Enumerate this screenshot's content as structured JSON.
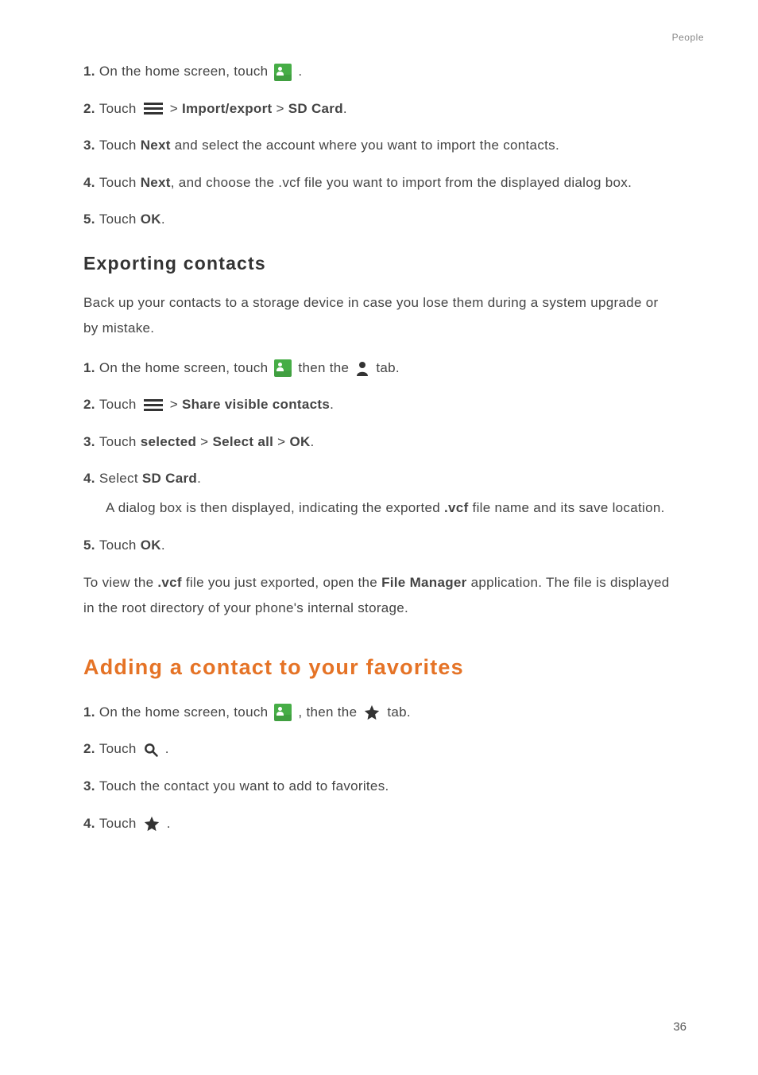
{
  "header": {
    "chapter": "People"
  },
  "import_steps": {
    "s1a": "On the home screen, touch ",
    "s1b": " .",
    "s2a": "Touch ",
    "s2b": " > ",
    "s2c": "Import/export",
    "s2d": " > ",
    "s2e": "SD Card",
    "s2f": ".",
    "s3a": "Touch ",
    "s3b": "Next",
    "s3c": " and select the account where you want to import the contacts.",
    "s4a": "Touch ",
    "s4b": "Next",
    "s4c": ", and choose the .vcf file you want to import from the displayed dialog box.",
    "s5a": "Touch ",
    "s5b": "OK",
    "s5c": "."
  },
  "export": {
    "heading": "Exporting contacts",
    "intro": "Back up your contacts to a storage device in case you lose them during a system upgrade or by mistake.",
    "s1a": "On the home screen, touch ",
    "s1b": " then the ",
    "s1c": " tab.",
    "s2a": "Touch ",
    "s2b": " > ",
    "s2c": "Share visible contacts",
    "s2d": ".",
    "s3a": "Touch ",
    "s3b": "selected",
    "s3c": " > ",
    "s3d": "Select all",
    "s3e": " > ",
    "s3f": "OK",
    "s3g": ".",
    "s4a": "Select ",
    "s4b": "SD Card",
    "s4c": ".",
    "s4note1": "A dialog box is then displayed, indicating the exported ",
    "s4note2": ".vcf",
    "s4note3": " file name and its save location.",
    "s5a": "Touch ",
    "s5b": "OK",
    "s5c": ".",
    "outro1": "To view the ",
    "outro2": ".vcf",
    "outro3": " file you just exported, open the ",
    "outro4": "File Manager",
    "outro5": " application. The file is displayed in the root directory of your phone's internal storage."
  },
  "favorites": {
    "heading": "Adding a contact to your favorites",
    "s1a": "On the home screen, touch ",
    "s1b": " , then the ",
    "s1c": " tab.",
    "s2a": "Touch ",
    "s2b": " .",
    "s3": "Touch the contact you want to add to favorites.",
    "s4a": "Touch ",
    "s4b": " ."
  },
  "page_number": "36"
}
